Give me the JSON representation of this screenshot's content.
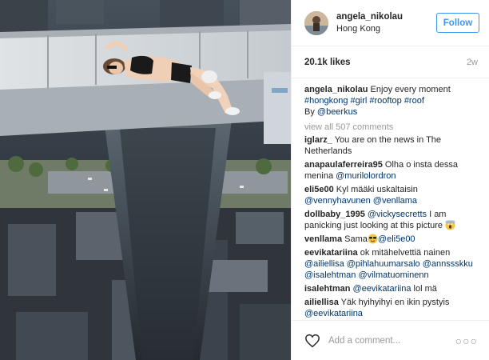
{
  "post": {
    "username": "angela_nikolau",
    "location": "Hong Kong",
    "follow_label": "Follow",
    "likes": "20.1k likes",
    "ago": "2w"
  },
  "caption": {
    "username": "angela_nikolau",
    "text": "Enjoy every moment",
    "hashtags": [
      "#hongkong",
      "#girl",
      "#rooftop",
      "#roof"
    ],
    "by_prefix": "By",
    "by_mention": "@beerkus"
  },
  "view_all": "view all 507 comments",
  "comments": [
    {
      "user": "iglarz_",
      "text": "You are on the news in The Netherlands",
      "mentions": []
    },
    {
      "user": "anapaulaferreira95",
      "text": "Olha o insta dessa menina",
      "mentions": [
        "@murilolordron"
      ]
    },
    {
      "user": "eli5e00",
      "text": "Kyl määki uskaltaisin",
      "mentions": [
        "@vennyhavunen",
        "@venllama"
      ]
    },
    {
      "user": "dollbaby_1995",
      "text_before": "",
      "mentions": [
        "@vickysecretts"
      ],
      "text": "I am panicking just looking at this picture"
    },
    {
      "user": "venllama",
      "text": "Sama",
      "mentions": [
        "@eli5e00"
      ]
    },
    {
      "user": "eevikatariina",
      "text": "ok mitähelvettiä nainen",
      "mentions": [
        "@ailiellisa",
        "@pihlahuumarsalo",
        "@annssskku",
        "@isalehtman",
        "@vilmatuominenn"
      ]
    },
    {
      "user": "isalehtman",
      "text": "lol mä",
      "mentions": [
        "@eevikatariina"
      ]
    },
    {
      "user": "ailiellisa",
      "text": "Yäk hyihyihyi en ikin pystyis",
      "mentions": [
        "@eevikatariina"
      ]
    }
  ],
  "footer": {
    "add_comment_placeholder": "Add a comment...",
    "more_label": "○○○"
  },
  "icons": {
    "heart": "heart-outline-icon",
    "emoji_cool": "sunglasses-emoji-icon",
    "emoji_scream": "scream-emoji-icon"
  },
  "colors": {
    "accent": "#3897f0",
    "link": "#003569",
    "muted": "#999999"
  }
}
